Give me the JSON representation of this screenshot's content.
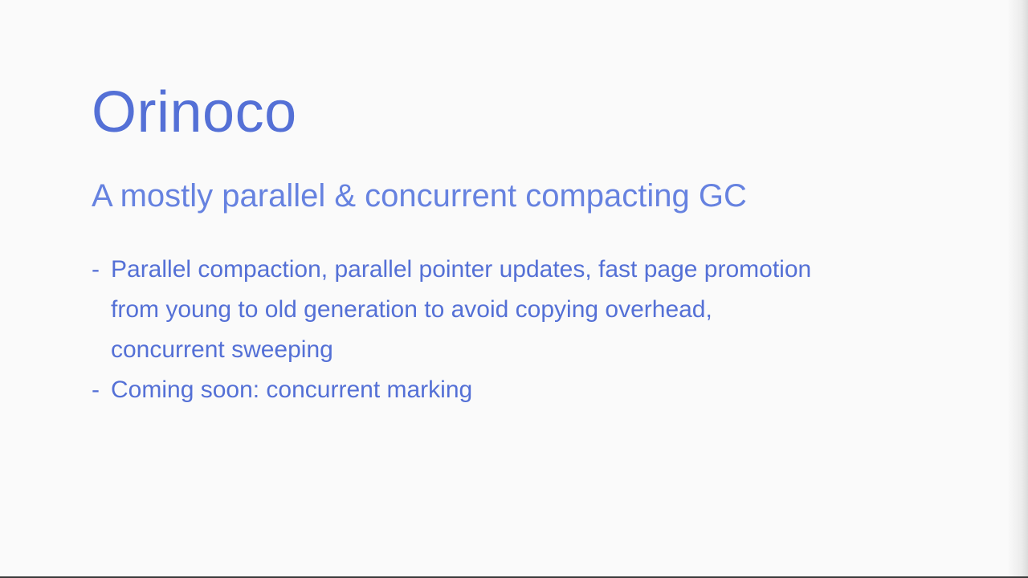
{
  "slide": {
    "title": "Orinoco",
    "subtitle": "A mostly parallel & concurrent compacting GC",
    "bullet_marker": "-",
    "bullets": [
      "Parallel compaction, parallel pointer updates, fast page promotion from young to old generation to avoid copying overhead, concurrent sweeping",
      "Coming soon: concurrent marking"
    ]
  },
  "colors": {
    "background": "#fafafa",
    "title": "#5470d6",
    "subtitle": "#6682e0",
    "body_text": "#5470d6"
  }
}
